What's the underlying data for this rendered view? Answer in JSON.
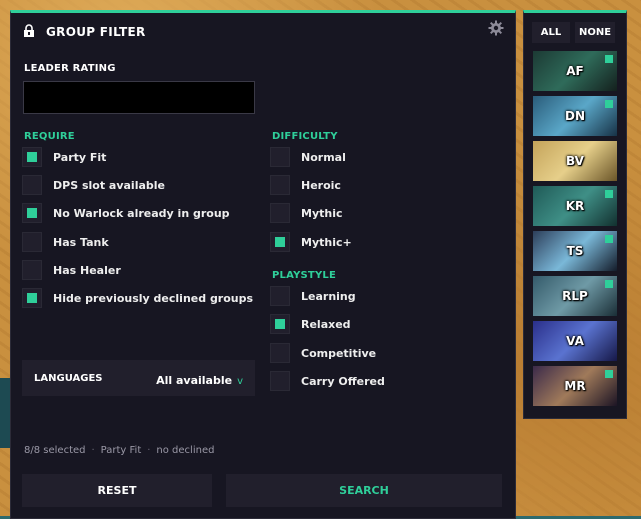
{
  "panel": {
    "title": "GROUP FILTER",
    "lock_icon": "lock-icon",
    "gear_icon": "gear-icon"
  },
  "leader_rating": {
    "label": "LEADER RATING",
    "value": "",
    "placeholder": ""
  },
  "require": {
    "title": "REQUIRE",
    "options": [
      {
        "label": "Party Fit",
        "checked": true
      },
      {
        "label": "DPS slot available",
        "checked": false
      },
      {
        "label": "No Warlock already in group",
        "checked": true
      },
      {
        "label": "Has Tank",
        "checked": false
      },
      {
        "label": "Has Healer",
        "checked": false
      },
      {
        "label": "Hide previously declined groups",
        "checked": true
      }
    ]
  },
  "difficulty": {
    "title": "DIFFICULTY",
    "options": [
      {
        "label": "Normal",
        "checked": false
      },
      {
        "label": "Heroic",
        "checked": false
      },
      {
        "label": "Mythic",
        "checked": false
      },
      {
        "label": "Mythic+",
        "checked": true
      }
    ]
  },
  "playstyle": {
    "title": "PLAYSTYLE",
    "options": [
      {
        "label": "Learning",
        "checked": false
      },
      {
        "label": "Relaxed",
        "checked": true
      },
      {
        "label": "Competitive",
        "checked": false
      },
      {
        "label": "Carry Offered",
        "checked": false
      }
    ]
  },
  "languages": {
    "label": "LANGUAGES",
    "value": "All available",
    "chevron": "v"
  },
  "status": {
    "selected": "8/8 selected",
    "fit": "Party Fit",
    "declined": "no declined",
    "separator": "·"
  },
  "buttons": {
    "reset": "RESET",
    "search": "SEARCH"
  },
  "side": {
    "all_label": "ALL",
    "none_label": "NONE",
    "dungeons": [
      {
        "label": "AF",
        "checked": true,
        "colors": [
          "#1c3a34",
          "#2f6b5a",
          "#14201d"
        ]
      },
      {
        "label": "DN",
        "checked": true,
        "colors": [
          "#2a5c7a",
          "#5aa7c8",
          "#173246"
        ]
      },
      {
        "label": "BV",
        "checked": false,
        "colors": [
          "#c4a35a",
          "#e6cf8a",
          "#6a5528"
        ]
      },
      {
        "label": "KR",
        "checked": true,
        "colors": [
          "#1f5a57",
          "#3f8f86",
          "#12302f"
        ]
      },
      {
        "label": "TS",
        "checked": true,
        "colors": [
          "#2d3e5a",
          "#7ab8d8",
          "#141c2a"
        ]
      },
      {
        "label": "RLP",
        "checked": true,
        "colors": [
          "#345a6a",
          "#6f9aa6",
          "#1a2e36"
        ]
      },
      {
        "label": "VA",
        "checked": false,
        "colors": [
          "#2a2f8a",
          "#5a73d0",
          "#161848"
        ]
      },
      {
        "label": "MR",
        "checked": true,
        "colors": [
          "#3b2a4a",
          "#a07a5a",
          "#1c1424"
        ]
      }
    ]
  },
  "colors": {
    "accent": "#2fcf9a",
    "panel_bg": "#171622",
    "row_bg": "#211f2c"
  }
}
